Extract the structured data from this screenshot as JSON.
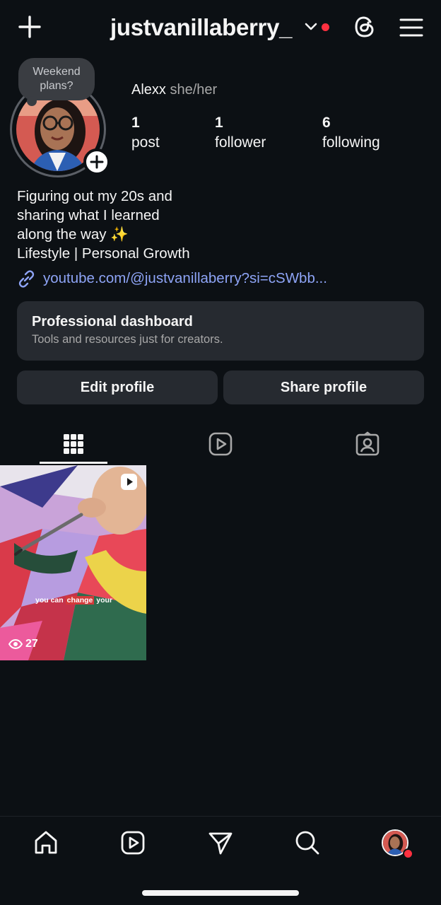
{
  "header": {
    "username": "justvanillaberry_",
    "notification_dot_color": "#ff3040",
    "icons": [
      "plus-icon",
      "chevron-down-icon",
      "threads-icon",
      "menu-icon"
    ]
  },
  "profile": {
    "note": "Weekend plans?",
    "name": "Alexx",
    "pronouns": "she/her",
    "stats": [
      {
        "num": "1",
        "label": "post"
      },
      {
        "num": "1",
        "label": "follower"
      },
      {
        "num": "6",
        "label": "following"
      }
    ],
    "bio_lines": [
      "Figuring out my 20s and",
      "sharing what I learned",
      "along the way ✨",
      "Lifestyle | Personal Growth"
    ],
    "link": "youtube.com/@justvanillaberry?si=cSWbb..."
  },
  "dashboard": {
    "title": "Professional dashboard",
    "subtitle": "Tools and resources just for creators."
  },
  "buttons": {
    "edit": "Edit profile",
    "share": "Share profile"
  },
  "tabs": [
    "grid-icon",
    "reels-icon",
    "tagged-icon"
  ],
  "post": {
    "caption_pre": "you can ",
    "caption_hl": "change",
    "caption_post": " your",
    "views": "27"
  },
  "bottom_nav": [
    "home-icon",
    "reels-icon",
    "direct-icon",
    "search-icon",
    "profile-avatar"
  ],
  "colors": {
    "background": "#0c1014",
    "card": "#262a30",
    "link": "#8ea4f6",
    "badge": "#ff3040"
  }
}
